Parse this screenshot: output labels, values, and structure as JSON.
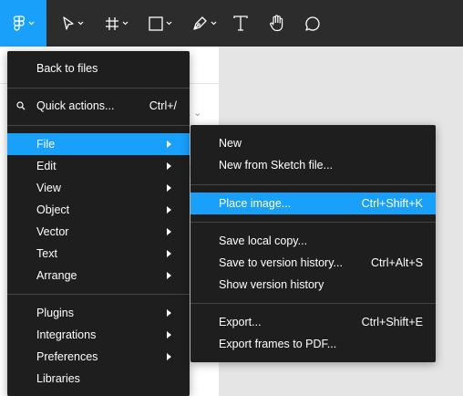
{
  "toolbar": {
    "tools": [
      {
        "icon": "figma-logo-icon",
        "has_caret": true,
        "active": true
      },
      {
        "icon": "move-pointer-icon",
        "has_caret": true
      },
      {
        "icon": "frame-hash-icon",
        "has_caret": true
      },
      {
        "icon": "rectangle-icon",
        "has_caret": true
      },
      {
        "icon": "pen-icon",
        "has_caret": true
      },
      {
        "icon": "text-icon",
        "has_caret": false
      },
      {
        "icon": "hand-icon",
        "has_caret": false
      },
      {
        "icon": "comment-icon",
        "has_caret": false
      }
    ],
    "active_color": "#18a0fb",
    "bg_color": "#2c2c2c"
  },
  "left_panel": {
    "stub_text": "1 ⌄"
  },
  "main_menu": {
    "items": [
      {
        "label": "Back to files"
      },
      {
        "label": "Quick actions...",
        "shortcut": "Ctrl+/",
        "icon": "search-icon"
      },
      {
        "label": "File",
        "submenu": true,
        "active": true
      },
      {
        "label": "Edit",
        "submenu": true
      },
      {
        "label": "View",
        "submenu": true
      },
      {
        "label": "Object",
        "submenu": true
      },
      {
        "label": "Vector",
        "submenu": true
      },
      {
        "label": "Text",
        "submenu": true
      },
      {
        "label": "Arrange",
        "submenu": true
      },
      {
        "label": "Plugins",
        "submenu": true
      },
      {
        "label": "Integrations",
        "submenu": true
      },
      {
        "label": "Preferences",
        "submenu": true
      },
      {
        "label": "Libraries"
      }
    ]
  },
  "file_menu": {
    "items": [
      {
        "label": "New"
      },
      {
        "label": "New from Sketch file..."
      },
      {
        "label": "Place image...",
        "shortcut": "Ctrl+Shift+K",
        "active": true
      },
      {
        "label": "Save local copy..."
      },
      {
        "label": "Save to version history...",
        "shortcut": "Ctrl+Alt+S"
      },
      {
        "label": "Show version history"
      },
      {
        "label": "Export...",
        "shortcut": "Ctrl+Shift+E"
      },
      {
        "label": "Export frames to PDF..."
      }
    ]
  }
}
